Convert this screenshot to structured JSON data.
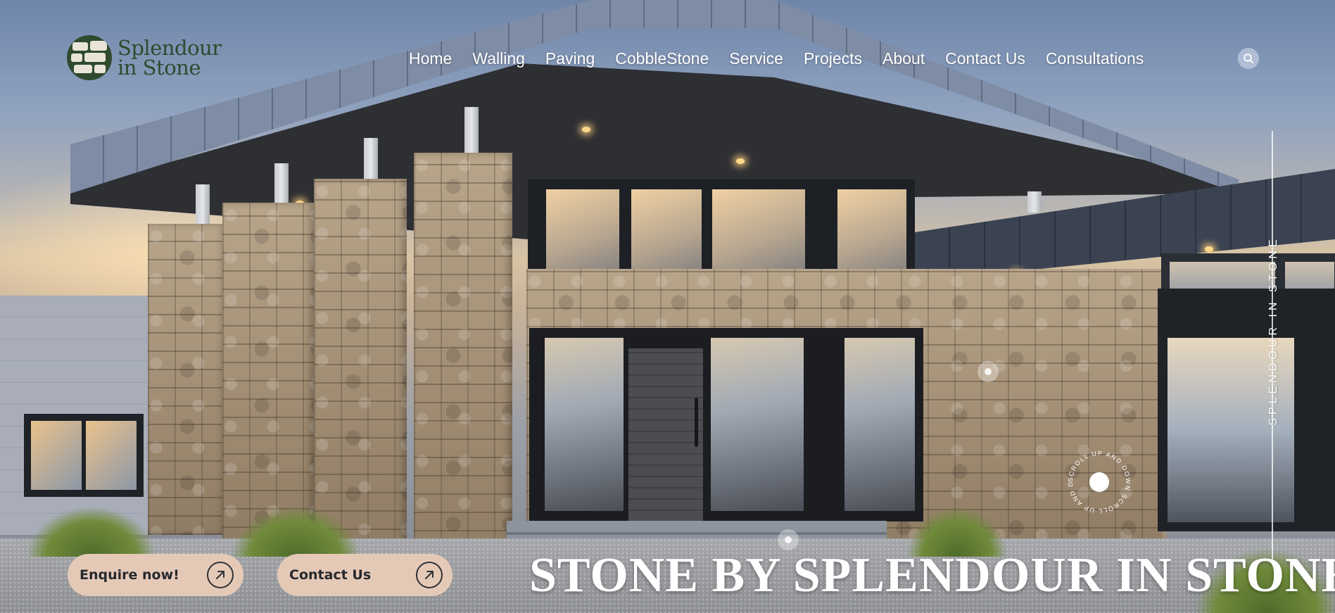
{
  "brand": {
    "name_line1": "Splendour",
    "name_line2": "in Stone",
    "color": "#2f4a2d"
  },
  "nav": {
    "items": [
      {
        "label": "Home"
      },
      {
        "label": "Walling"
      },
      {
        "label": "Paving"
      },
      {
        "label": "CobbleStone"
      },
      {
        "label": "Service"
      },
      {
        "label": "Projects"
      },
      {
        "label": "About"
      },
      {
        "label": "Contact Us"
      },
      {
        "label": "Consultations"
      }
    ],
    "search_icon": "search-icon"
  },
  "side": {
    "text": "SPLENDOUR IN STONE"
  },
  "scroll_badge": {
    "text": "SCROLL UP AND DOWN SCROLL UP AND DOWN"
  },
  "cta": {
    "enquire_label": "Enquire now!",
    "contact_label": "Contact Us",
    "icon": "arrow-up-right-icon",
    "color": "#e5c9b7"
  },
  "hero": {
    "headline": "STONE BY SPLENDOUR IN STONE"
  }
}
